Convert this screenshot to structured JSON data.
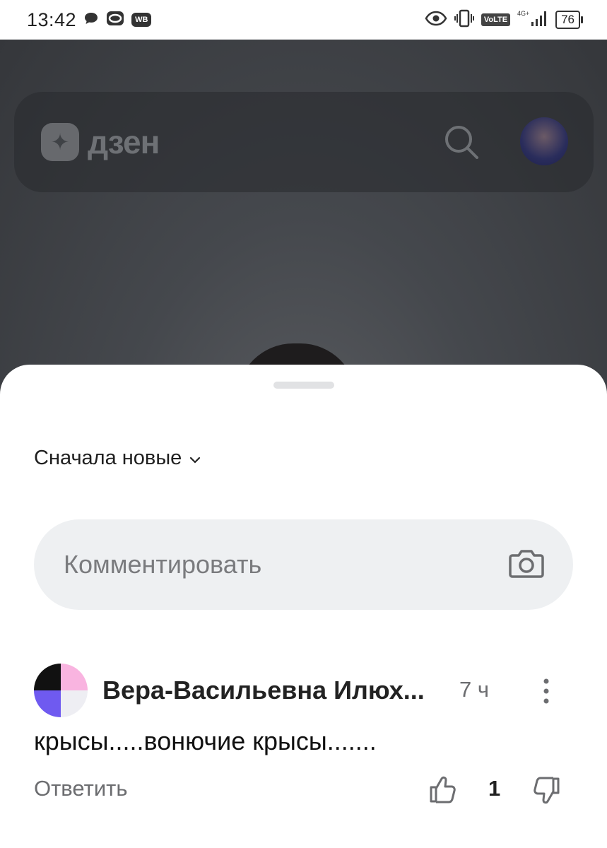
{
  "status_bar": {
    "time": "13:42",
    "wb_badge": "WB",
    "volte": "VoLTE",
    "network": "4G+",
    "battery": "76",
    "icons": [
      "message-bubble-icon",
      "oval-app-icon",
      "wb-icon",
      "eye-icon",
      "vibrate-icon",
      "signal-icon",
      "battery-icon"
    ]
  },
  "header": {
    "logo_text": "дзен",
    "icons": [
      "dzen-logo-icon",
      "search-icon",
      "avatar"
    ]
  },
  "sheet": {
    "sort_label": "Сначала новые",
    "comment_placeholder": "Комментировать"
  },
  "comment": {
    "author": "Вера-Васильевна Илюх...",
    "time": "7 ч",
    "text": "крысы.....вонючие крысы.......",
    "reply_label": "Ответить",
    "likes": "1",
    "avatar_colors": [
      "#111111",
      "#f9b4e0",
      "#6f5af0",
      "#eeeef3"
    ]
  }
}
